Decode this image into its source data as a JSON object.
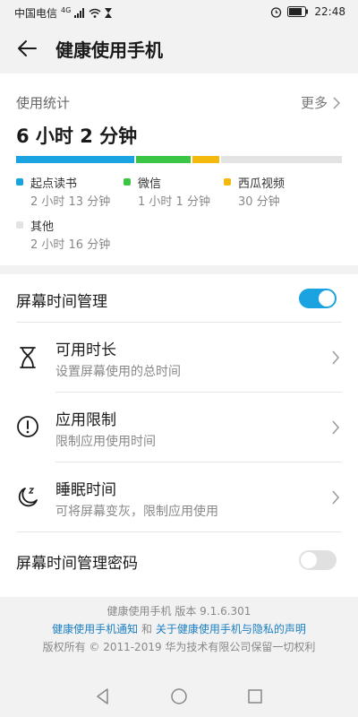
{
  "status": {
    "carrier": "中国电信",
    "network": "4G",
    "time": "22:48"
  },
  "header": {
    "title": "健康使用手机"
  },
  "stats": {
    "title": "使用统计",
    "more": "更多",
    "total": "6 小时 2 分钟",
    "apps": [
      {
        "name": "起点读书",
        "duration": "2 小时 13 分钟",
        "minutes": 133,
        "color": "#1aa3e0"
      },
      {
        "name": "微信",
        "duration": "1 小时 1 分钟",
        "minutes": 61,
        "color": "#3cc445"
      },
      {
        "name": "西瓜视频",
        "duration": "30 分钟",
        "minutes": 30,
        "color": "#f3b90c"
      },
      {
        "name": "其他",
        "duration": "2 小时 16 分钟",
        "minutes": 136,
        "color": "#e3e3e3"
      }
    ]
  },
  "management": {
    "label": "屏幕时间管理",
    "enabled": true,
    "items": [
      {
        "title": "可用时长",
        "subtitle": "设置屏幕使用的总时间",
        "icon": "hourglass-icon"
      },
      {
        "title": "应用限制",
        "subtitle": "限制应用使用时间",
        "icon": "exclamation-circle-icon"
      },
      {
        "title": "睡眠时间",
        "subtitle": "可将屏幕变灰，限制应用使用",
        "icon": "moon-sleep-icon"
      }
    ],
    "password_label": "屏幕时间管理密码",
    "password_enabled": false
  },
  "footer": {
    "version": "健康使用手机 版本 9.1.6.301",
    "notice_link": "健康使用手机通知",
    "and": "和",
    "privacy_link": "关于健康使用手机与隐私的声明",
    "copyright": "版权所有 © 2011-2019 华为技术有限公司保留一切权利"
  },
  "colors": {
    "accent": "#1aa3e0",
    "toggle_off": "#e0e0e0"
  }
}
